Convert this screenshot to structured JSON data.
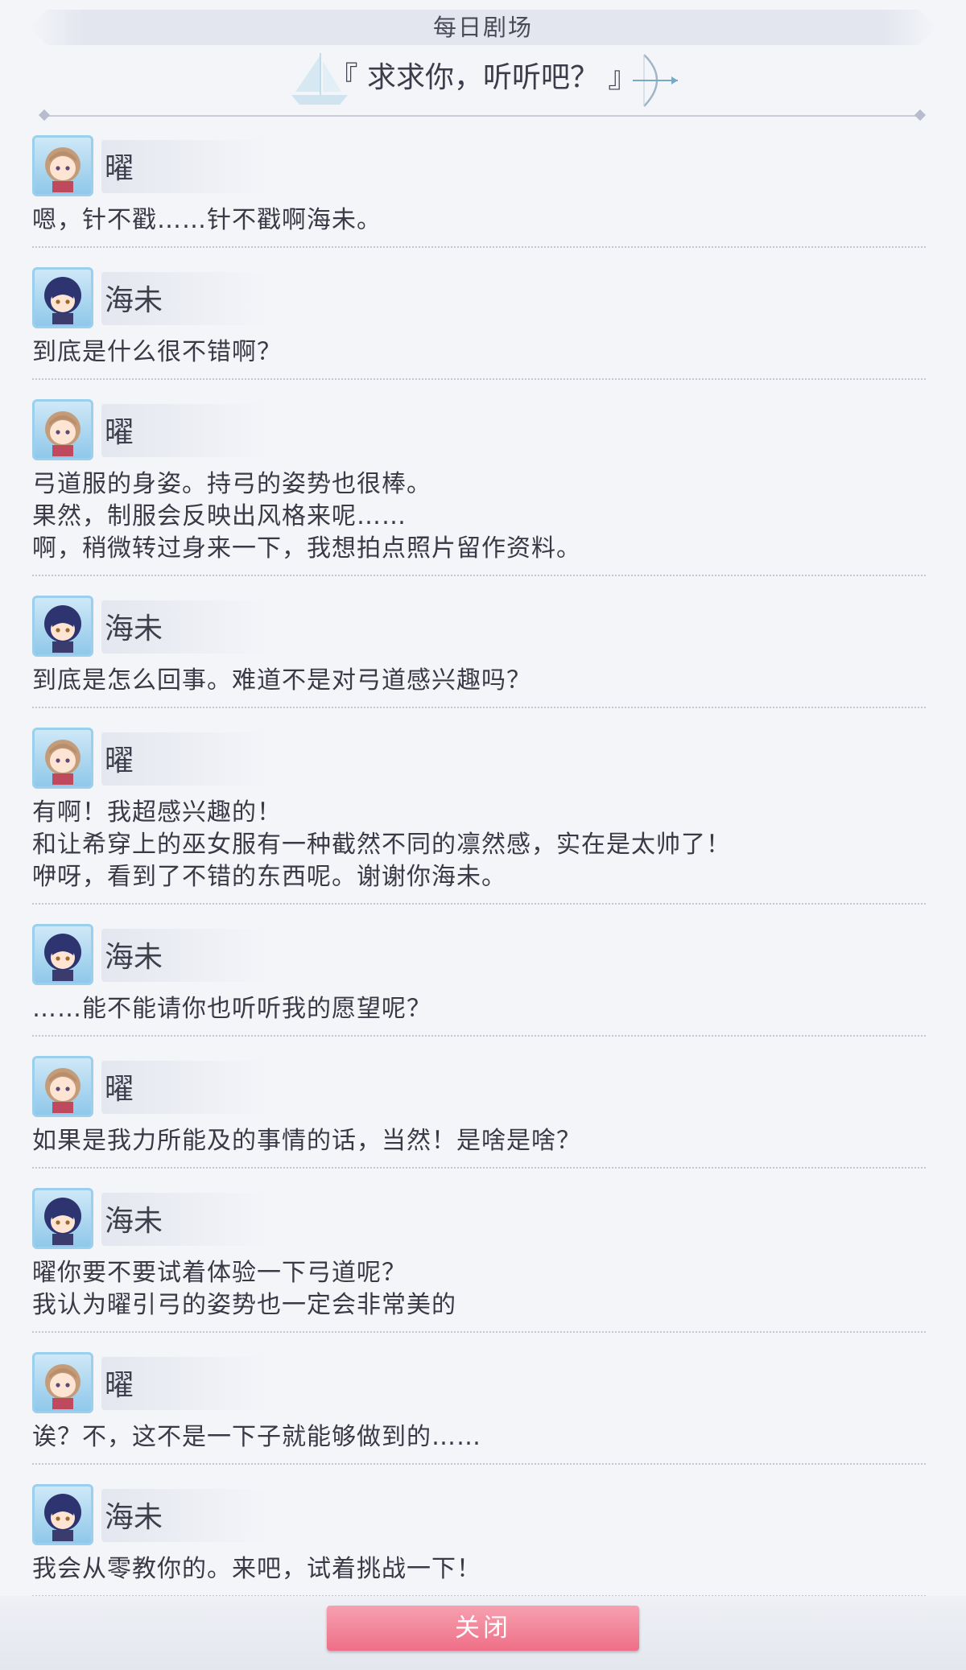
{
  "header": {
    "title": "每日剧场"
  },
  "episode": {
    "title": "『 求求你，听听吧？ 』"
  },
  "dialogue": [
    {
      "speaker": "曜",
      "avatar": "you-avatar",
      "text": "嗯，针不戳……针不戳啊海未。"
    },
    {
      "speaker": "海未",
      "avatar": "umi-avatar",
      "text": "到底是什么很不错啊？"
    },
    {
      "speaker": "曜",
      "avatar": "you-avatar",
      "text": "弓道服的身姿。持弓的姿势也很棒。\n果然，制服会反映出风格来呢……\n啊，稍微转过身来一下，我想拍点照片留作资料。"
    },
    {
      "speaker": "海未",
      "avatar": "umi-avatar",
      "text": "到底是怎么回事。难道不是对弓道感兴趣吗？"
    },
    {
      "speaker": "曜",
      "avatar": "you-avatar",
      "text": "有啊！我超感兴趣的！\n和让希穿上的巫女服有一种截然不同的凛然感，实在是太帅了！\n咿呀，看到了不错的东西呢。谢谢你海未。"
    },
    {
      "speaker": "海未",
      "avatar": "umi-avatar",
      "text": "……能不能请你也听听我的愿望呢？"
    },
    {
      "speaker": "曜",
      "avatar": "you-avatar",
      "text": "如果是我力所能及的事情的话，当然！是啥是啥？"
    },
    {
      "speaker": "海未",
      "avatar": "umi-avatar",
      "text": "曜你要不要试着体验一下弓道呢？\n我认为曜引弓的姿势也一定会非常美的"
    },
    {
      "speaker": "曜",
      "avatar": "you-avatar",
      "text": "诶？不，这不是一下子就能够做到的……"
    },
    {
      "speaker": "海未",
      "avatar": "umi-avatar",
      "text": "我会从零教你的。来吧，试着挑战一下！"
    }
  ],
  "footer": {
    "close_label": "关闭"
  },
  "colors": {
    "background": "#f4f5f9",
    "close_button": "#ee6f87",
    "avatar_frame": "#9ad0ee"
  }
}
